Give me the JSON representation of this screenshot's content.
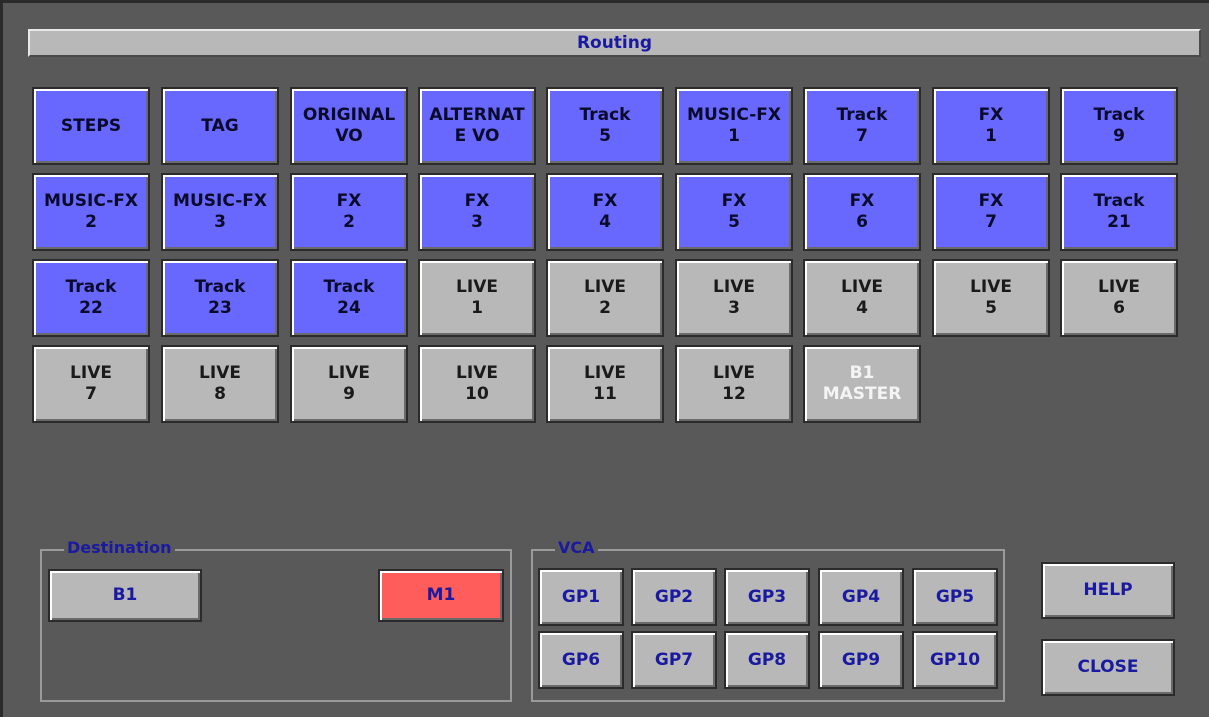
{
  "title": "Routing",
  "routes": [
    {
      "line1": "STEPS",
      "line2": "",
      "state": "blue"
    },
    {
      "line1": "TAG",
      "line2": "",
      "state": "blue"
    },
    {
      "line1": "ORIGINAL",
      "line2": "VO",
      "state": "blue"
    },
    {
      "line1": "ALTERNAT",
      "line2": "E VO",
      "state": "blue"
    },
    {
      "line1": "Track",
      "line2": "5",
      "state": "blue"
    },
    {
      "line1": "MUSIC-FX",
      "line2": "1",
      "state": "blue"
    },
    {
      "line1": "Track",
      "line2": "7",
      "state": "blue"
    },
    {
      "line1": "FX",
      "line2": "1",
      "state": "blue"
    },
    {
      "line1": "Track",
      "line2": "9",
      "state": "blue"
    },
    {
      "line1": "MUSIC-FX",
      "line2": "2",
      "state": "blue"
    },
    {
      "line1": "MUSIC-FX",
      "line2": "3",
      "state": "blue"
    },
    {
      "line1": "FX",
      "line2": "2",
      "state": "blue"
    },
    {
      "line1": "FX",
      "line2": "3",
      "state": "blue"
    },
    {
      "line1": "FX",
      "line2": "4",
      "state": "blue"
    },
    {
      "line1": "FX",
      "line2": "5",
      "state": "blue"
    },
    {
      "line1": "FX",
      "line2": "6",
      "state": "blue"
    },
    {
      "line1": "FX",
      "line2": "7",
      "state": "blue"
    },
    {
      "line1": "Track",
      "line2": "21",
      "state": "blue"
    },
    {
      "line1": "Track",
      "line2": "22",
      "state": "blue"
    },
    {
      "line1": "Track",
      "line2": "23",
      "state": "blue"
    },
    {
      "line1": "Track",
      "line2": "24",
      "state": "blue"
    },
    {
      "line1": "LIVE",
      "line2": "1",
      "state": "gray"
    },
    {
      "line1": "LIVE",
      "line2": "2",
      "state": "gray"
    },
    {
      "line1": "LIVE",
      "line2": "3",
      "state": "gray"
    },
    {
      "line1": "LIVE",
      "line2": "4",
      "state": "gray"
    },
    {
      "line1": "LIVE",
      "line2": "5",
      "state": "gray"
    },
    {
      "line1": "LIVE",
      "line2": "6",
      "state": "gray"
    },
    {
      "line1": "LIVE",
      "line2": "7",
      "state": "gray"
    },
    {
      "line1": "LIVE",
      "line2": "8",
      "state": "gray"
    },
    {
      "line1": "LIVE",
      "line2": "9",
      "state": "gray"
    },
    {
      "line1": "LIVE",
      "line2": "10",
      "state": "gray"
    },
    {
      "line1": "LIVE",
      "line2": "11",
      "state": "gray"
    },
    {
      "line1": "LIVE",
      "line2": "12",
      "state": "gray"
    },
    {
      "line1": "B1",
      "line2": "MASTER",
      "state": "master"
    }
  ],
  "destination": {
    "label": "Destination",
    "b1": "B1",
    "m1": "M1"
  },
  "vca": {
    "label": "VCA",
    "groups": [
      "GP1",
      "GP2",
      "GP3",
      "GP4",
      "GP5",
      "GP6",
      "GP7",
      "GP8",
      "GP9",
      "GP10"
    ]
  },
  "actions": {
    "help": "HELP",
    "close": "CLOSE"
  },
  "colors": {
    "active": "#6868ff",
    "inactive": "#b8b8b8",
    "selected_destination": "#ff5c5c",
    "label_text": "#1a1aa0"
  }
}
